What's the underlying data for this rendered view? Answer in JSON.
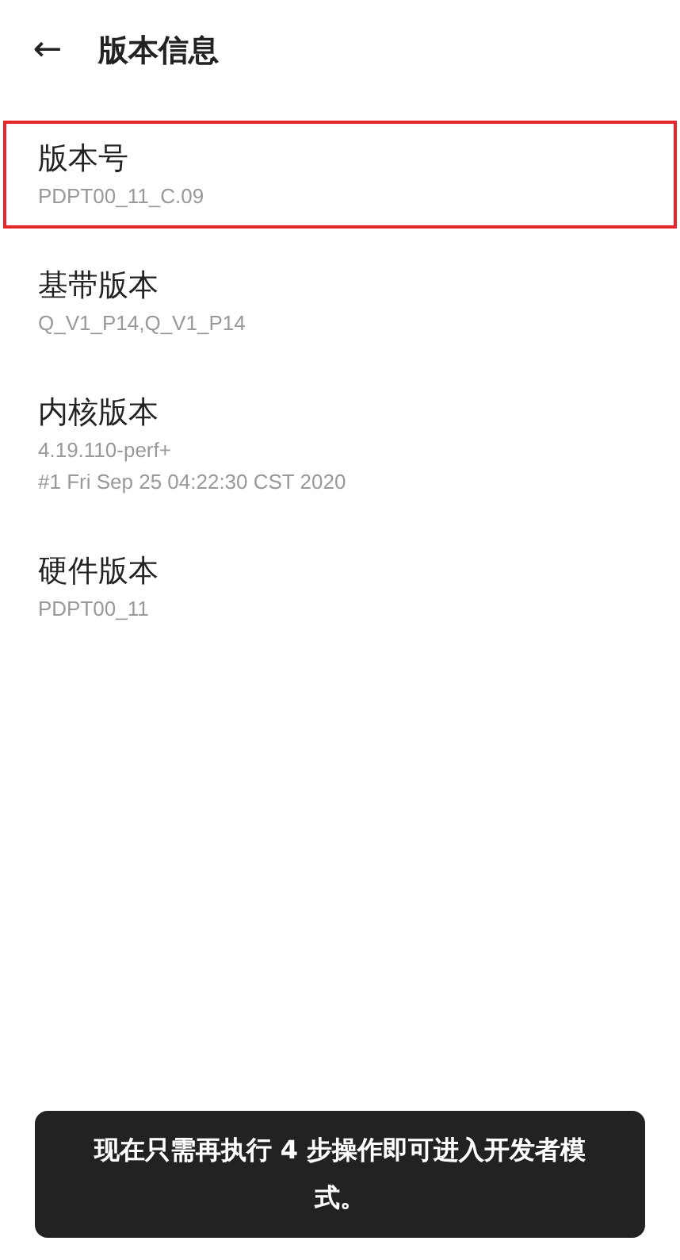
{
  "header": {
    "back": "←",
    "title": "版本信息"
  },
  "items": [
    {
      "label": "版本号",
      "values": [
        "PDPT00_11_C.09"
      ],
      "highlighted": true
    },
    {
      "label": "基带版本",
      "values": [
        "Q_V1_P14,Q_V1_P14"
      ],
      "highlighted": false
    },
    {
      "label": "内核版本",
      "values": [
        "4.19.110-perf+",
        "#1 Fri Sep 25 04:22:30 CST 2020"
      ],
      "highlighted": false
    },
    {
      "label": "硬件版本",
      "values": [
        "PDPT00_11"
      ],
      "highlighted": false
    }
  ],
  "toast": "现在只需再执行 4 步操作即可进入开发者模式。"
}
